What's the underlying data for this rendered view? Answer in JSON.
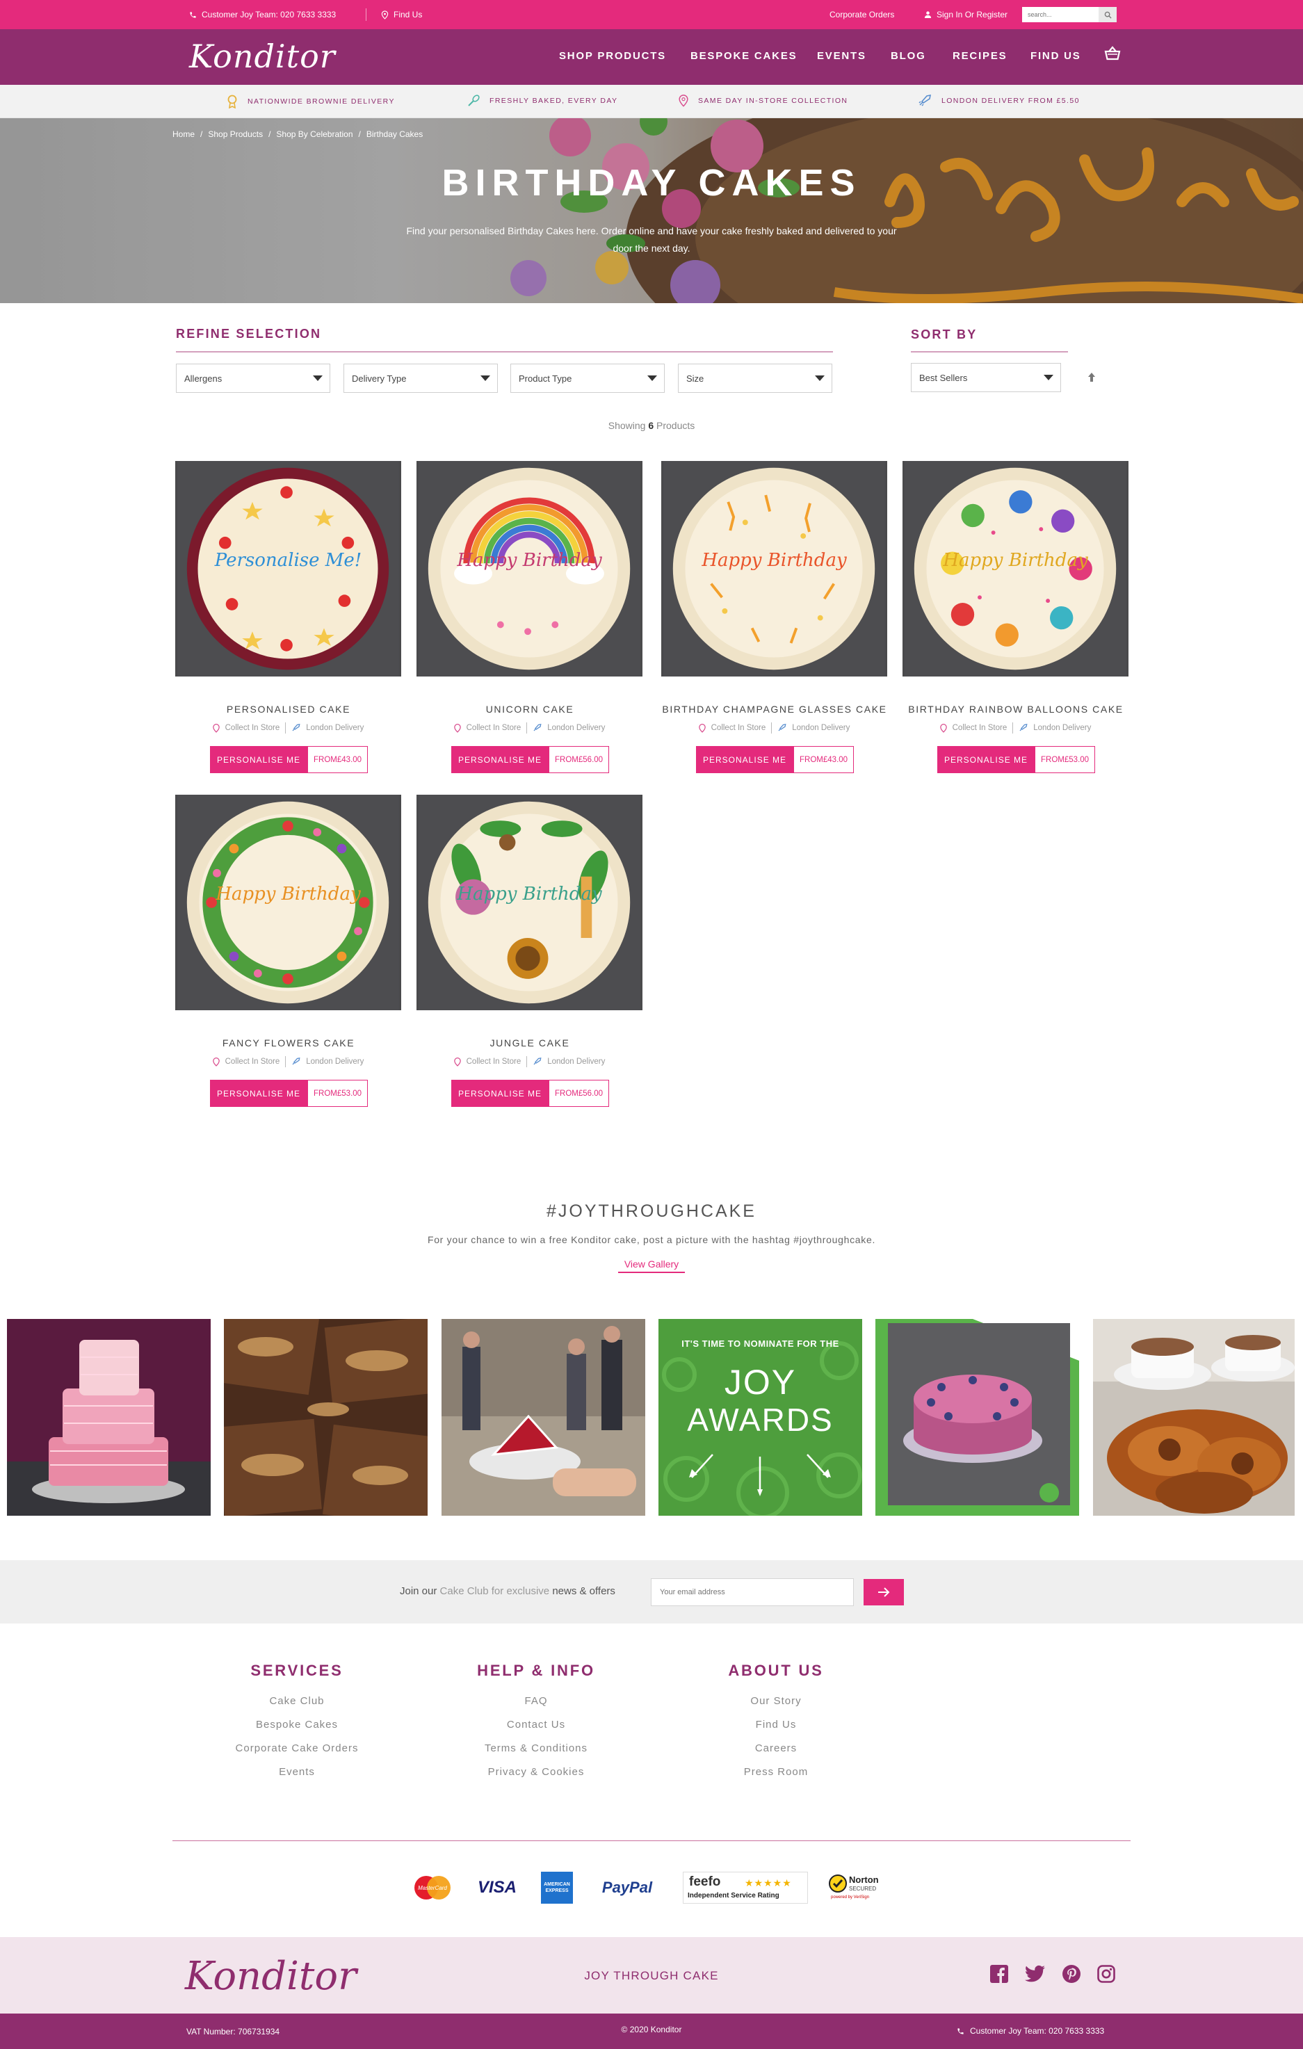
{
  "topbar": {
    "phone": "Customer Joy Team: 020 7633 3333",
    "find_us": "Find Us",
    "corporate": "Corporate Orders",
    "sign_in": "Sign In Or Register",
    "search_placeholder": "search..."
  },
  "nav": {
    "logo": "Konditor",
    "links": [
      "SHOP PRODUCTS",
      "BESPOKE CAKES",
      "EVENTS",
      "BLOG",
      "RECIPES",
      "FIND US"
    ]
  },
  "usps": [
    "NATIONWIDE BROWNIE DELIVERY",
    "FRESHLY BAKED, EVERY DAY",
    "SAME DAY IN-STORE COLLECTION",
    "LONDON DELIVERY FROM £5.50"
  ],
  "breadcrumb": [
    "Home",
    "Shop Products",
    "Shop By Celebration",
    "Birthday Cakes"
  ],
  "hero": {
    "title": "BIRTHDAY CAKES",
    "description": "Find your personalised Birthday Cakes here. Order online and have your cake freshly baked and delivered to your door the next day."
  },
  "refine": {
    "title": "REFINE SELECTION",
    "filters": [
      "Allergens",
      "Delivery Type",
      "Product Type",
      "Size"
    ],
    "sort_title": "SORT BY",
    "sort_value": "Best Sellers"
  },
  "showing": {
    "prefix": "Showing",
    "count": "6",
    "suffix": "Products"
  },
  "product_labels": {
    "collect": "Collect In Store",
    "delivery": "London Delivery",
    "button": "PERSONALISE ME"
  },
  "products": [
    {
      "name": "PERSONALISED CAKE",
      "price": "FROM£43.00",
      "plaque": "Personalise Me!"
    },
    {
      "name": "UNICORN CAKE",
      "price": "FROM£56.00",
      "plaque": "Happy Birthday"
    },
    {
      "name": "BIRTHDAY CHAMPAGNE GLASSES CAKE",
      "price": "FROM£43.00",
      "plaque": "Happy Birthday"
    },
    {
      "name": "BIRTHDAY RAINBOW BALLOONS CAKE",
      "price": "FROM£53.00",
      "plaque": "Happy Birthday"
    },
    {
      "name": "FANCY FLOWERS CAKE",
      "price": "FROM£53.00",
      "plaque": "Happy Birthday"
    },
    {
      "name": "JUNGLE CAKE",
      "price": "FROM£56.00",
      "plaque": "Happy Birthday"
    }
  ],
  "joy": {
    "title": "#JOYTHROUGHCAKE",
    "description": "For your chance to win a free Konditor  cake, post a picture with the hashtag #joythroughcake.",
    "link": "View Gallery",
    "awards": {
      "line1": "IT'S TIME TO NOMINATE FOR THE",
      "line2": "JOY",
      "line3": "AWARDS"
    }
  },
  "newsletter": {
    "join": "Join our",
    "club": "Cake Club",
    "for": "for exclusive",
    "news": "news & offers",
    "placeholder": "Your email address"
  },
  "footer": {
    "columns": [
      {
        "title": "SERVICES",
        "links": [
          "Cake Club",
          "Bespoke Cakes",
          "Corporate Cake Orders",
          "Events"
        ]
      },
      {
        "title": "HELP & INFO",
        "links": [
          "FAQ",
          "Contact Us",
          "Terms & Conditions",
          "Privacy & Cookies"
        ]
      },
      {
        "title": "ABOUT US",
        "links": [
          "Our Story",
          "Find Us",
          "Careers",
          "Press Room"
        ]
      }
    ],
    "payments": {
      "mastercard": "MasterCard",
      "visa": "VISA",
      "amex": "AMERICAN EXPRESS",
      "paypal": "PayPal",
      "feefo": "feefo",
      "feefo_sub": "Independent Service Rating",
      "norton": "Norton",
      "norton_sub": "SECURED",
      "norton_by": "powered by VeriSign"
    },
    "logo": "Konditor",
    "tagline": "JOY THROUGH CAKE",
    "vat": "VAT Number: 706731934",
    "copyright": "© 2020 Konditor",
    "phone": "Customer Joy Team: 020 7633 3333"
  },
  "colors": {
    "pink": "#e42a7c",
    "plum": "#8f2d6e",
    "grey_band": "#efefef"
  }
}
